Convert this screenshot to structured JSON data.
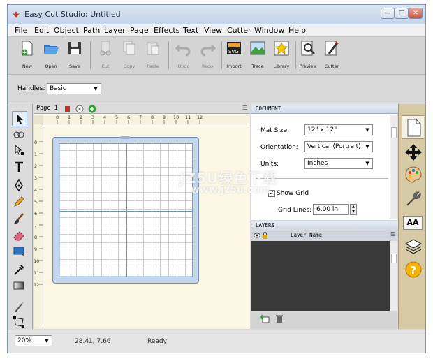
{
  "window": {
    "title": "Easy Cut Studio: Untitled"
  },
  "menu": [
    "File",
    "Edit",
    "Object",
    "Path",
    "Layer",
    "Page",
    "Effects",
    "Text",
    "View",
    "Cutter",
    "Window",
    "Help"
  ],
  "toolbar": {
    "new": "New",
    "open": "Open",
    "save": "Save",
    "cut": "Cut",
    "copy": "Copy",
    "paste": "Paste",
    "undo": "Undo",
    "redo": "Redo",
    "import": "Import",
    "trace": "Trace",
    "library": "Library",
    "preview": "Preview",
    "cutter": "Cutter"
  },
  "options": {
    "handles_label": "Handles:",
    "handles_value": "Basic"
  },
  "canvas": {
    "page_tab": "Page 1",
    "ruler_top": [
      "0",
      "1",
      "2",
      "3",
      "4",
      "5",
      "6",
      "7",
      "8",
      "9",
      "10",
      "11",
      "12"
    ],
    "ruler_left": [
      "0",
      "1",
      "2",
      "3",
      "4",
      "5",
      "6",
      "7",
      "8",
      "9",
      "10",
      "11",
      "12"
    ]
  },
  "document": {
    "header": "DOCUMENT",
    "mat_size_label": "Mat Size:",
    "mat_size_value": "12\" x 12\"",
    "orientation_label": "Orientation:",
    "orientation_value": "Vertical (Portrait)",
    "units_label": "Units:",
    "units_value": "Inches",
    "show_grid_label": "Show Grid",
    "show_grid_checked": true,
    "grid_lines_label": "Grid Lines:",
    "grid_lines_value": "6.00 in"
  },
  "layers": {
    "header": "LAYERS",
    "column_name": "Layer Name"
  },
  "status": {
    "zoom": "20%",
    "coords": "28.41, 7.66",
    "state": "Ready"
  },
  "watermark": {
    "line1": "JZ5U绿色下载",
    "line2": "www.jz5u.com"
  },
  "colors": {
    "accent": "#6a8fbd",
    "mat": "#c4d7ec",
    "workspace": "#fbf7e4",
    "right_strip": "#d6c9a6"
  }
}
